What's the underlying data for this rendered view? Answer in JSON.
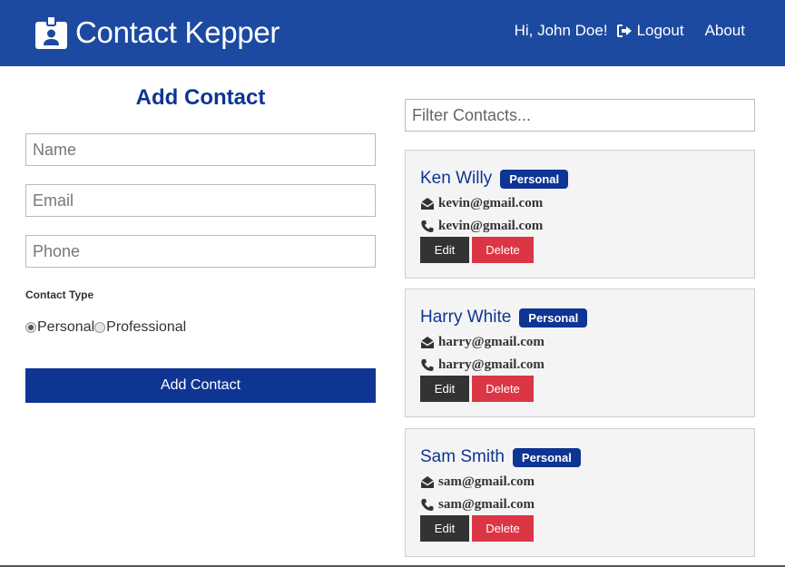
{
  "navbar": {
    "brand": "Contact Kepper",
    "greeting": "Hi, John Doe!",
    "logout_label": "Logout",
    "about_label": "About",
    "background_color": "#1c4aa1",
    "brand_icon": "id-badge-icon",
    "logout_icon": "sign-out-icon"
  },
  "form": {
    "title": "Add Contact",
    "name_placeholder": "Name",
    "email_placeholder": "Email",
    "phone_placeholder": "Phone",
    "contact_type_label": "Contact Type",
    "options": [
      {
        "label": "Personal",
        "checked": true
      },
      {
        "label": "Professional",
        "checked": false
      }
    ],
    "submit_label": "Add Contact",
    "accent_color": "#0e3594"
  },
  "filter": {
    "placeholder": "Filter Contacts..."
  },
  "contacts": [
    {
      "name": "Ken Willy",
      "type": "Personal",
      "email": "kevin@gmail.com",
      "phone": "kevin@gmail.com",
      "edit_label": "Edit",
      "delete_label": "Delete"
    },
    {
      "name": "Harry White",
      "type": "Personal",
      "email": "harry@gmail.com",
      "phone": "harry@gmail.com",
      "edit_label": "Edit",
      "delete_label": "Delete"
    },
    {
      "name": "Sam Smith",
      "type": "Personal",
      "email": "sam@gmail.com",
      "phone": "sam@gmail.com",
      "edit_label": "Edit",
      "delete_label": "Delete"
    }
  ],
  "colors": {
    "delete": "#dc3545",
    "edit": "#333333",
    "card_bg": "#f4f4f4"
  }
}
